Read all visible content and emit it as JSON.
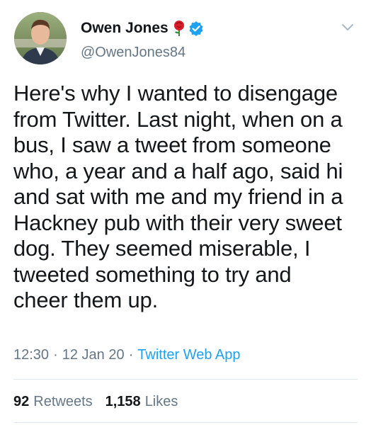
{
  "author": {
    "display_name": "Owen Jones",
    "handle": "@OwenJones84",
    "emoji_icon": "rose-icon",
    "verified_icon": "verified-badge-icon"
  },
  "tweet": {
    "text": "Here's why I wanted to disengage\nfrom Twitter. Last night, when on a\nbus, I saw a tweet from someone\nwho, a year and a half ago, said hi\nand sat with me and my friend in a\nHackney pub with their very sweet\ndog. They seemed miserable, I\ntweeted something to try and\ncheer them up."
  },
  "meta": {
    "time": "12:30",
    "sep1": "·",
    "date": "12 Jan 20",
    "sep2": "·",
    "source": "Twitter Web App"
  },
  "stats": {
    "retweets_count": "92",
    "retweets_label": "Retweets",
    "likes_count": "1,158",
    "likes_label": "Likes"
  },
  "colors": {
    "text": "#14171a",
    "secondary": "#657786",
    "accent": "#1da1f2",
    "divider": "#e1e8ed"
  }
}
